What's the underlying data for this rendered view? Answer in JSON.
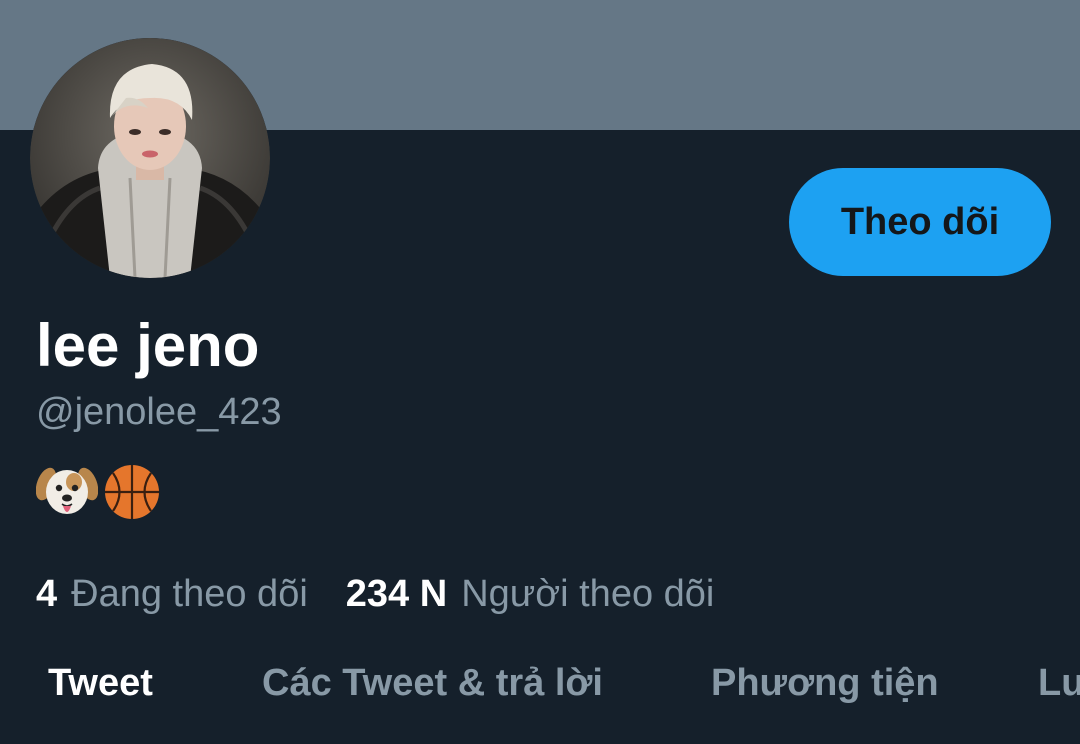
{
  "profile": {
    "display_name": "lee jeno",
    "handle": "@jenolee_423",
    "bio_emojis": [
      "dog-face-emoji",
      "basketball-emoji"
    ]
  },
  "actions": {
    "follow_label": "Theo dõi"
  },
  "stats": {
    "following_count": "4",
    "following_label": "Đang theo dõi",
    "followers_count": "234 N",
    "followers_label": "Người theo dõi"
  },
  "tabs": [
    {
      "label": "Tweet",
      "active": true
    },
    {
      "label": "Các Tweet & trả lời",
      "active": false
    },
    {
      "label": "Phương tiện",
      "active": false
    },
    {
      "label": "Lượt thích",
      "active": false
    }
  ],
  "colors": {
    "background": "#15202b",
    "banner": "#657786",
    "accent": "#1da1f2",
    "secondary_text": "#8899a6",
    "primary_text": "#ffffff"
  }
}
